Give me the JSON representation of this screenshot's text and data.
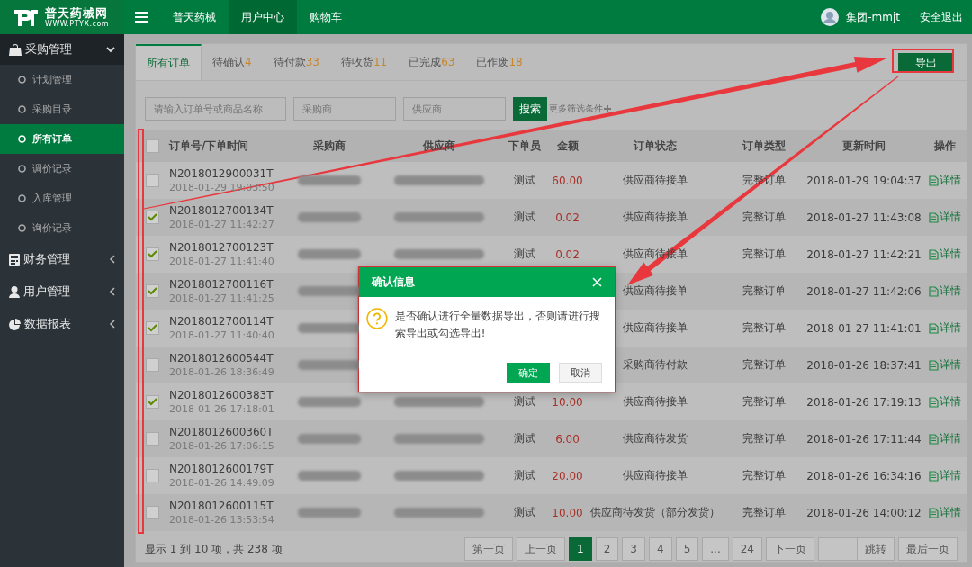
{
  "brand": {
    "name": "普天药械网",
    "url": "WWW.PTYX.com"
  },
  "top_nav": {
    "items": [
      {
        "label": "普天药械",
        "selected": false
      },
      {
        "label": "用户中心",
        "selected": true
      },
      {
        "label": "购物车",
        "selected": false
      }
    ],
    "user": "集团-mmjt",
    "logout": "安全退出"
  },
  "sidebar": {
    "groups": [
      {
        "label": "采购管理",
        "expanded": true,
        "children": [
          {
            "label": "计划管理",
            "selected": false
          },
          {
            "label": "采购目录",
            "selected": false
          },
          {
            "label": "所有订单",
            "selected": true
          },
          {
            "label": "调价记录",
            "selected": false
          },
          {
            "label": "入库管理",
            "selected": false
          },
          {
            "label": "询价记录",
            "selected": false
          }
        ]
      },
      {
        "label": "财务管理",
        "expanded": false
      },
      {
        "label": "用户管理",
        "expanded": false
      },
      {
        "label": "数据报表",
        "expanded": false
      }
    ]
  },
  "tabs": [
    {
      "label": "所有订单",
      "selected": true
    },
    {
      "label": "待确认",
      "count": "4",
      "selected": false
    },
    {
      "label": "待付款",
      "count": "33",
      "selected": false
    },
    {
      "label": "待收货",
      "count": "11",
      "selected": false
    },
    {
      "label": "已完成",
      "count": "63",
      "selected": false
    },
    {
      "label": "已作废",
      "count": "18",
      "selected": false
    }
  ],
  "export_button": "导出",
  "filters": {
    "fields": [
      {
        "placeholder": "请输入订单号或商品名称"
      },
      {
        "placeholder": "采购商"
      },
      {
        "placeholder": "供应商"
      }
    ],
    "search_button": "搜索",
    "more_filters": "更多筛选条件"
  },
  "table": {
    "select_all": {
      "checked": false
    },
    "columns": [
      "订单号/下单时间",
      "采购商",
      "供应商",
      "下单员",
      "金额",
      "订单状态",
      "订单类型",
      "更新时间",
      "操作"
    ],
    "rows": [
      {
        "checked": false,
        "order_no": "N2018012900031T",
        "created": "2018-01-29 19:03:50",
        "staff": "测试",
        "amount": "60.00",
        "status": "供应商待接单",
        "type": "完整订单",
        "updated": "2018-01-29 19:04:37",
        "action": "详情"
      },
      {
        "checked": true,
        "order_no": "N2018012700134T",
        "created": "2018-01-27 11:42:27",
        "staff": "测试",
        "amount": "0.02",
        "status": "供应商待接单",
        "type": "完整订单",
        "updated": "2018-01-27 11:43:08",
        "action": "详情"
      },
      {
        "checked": true,
        "order_no": "N2018012700123T",
        "created": "2018-01-27 11:41:40",
        "staff": "测试",
        "amount": "0.02",
        "status": "供应商待接单",
        "type": "完整订单",
        "updated": "2018-01-27 11:42:21",
        "action": "详情"
      },
      {
        "checked": true,
        "order_no": "N2018012700116T",
        "created": "2018-01-27 11:41:25",
        "status": "供应商待接单",
        "type": "完整订单",
        "updated": "2018-01-27 11:42:06",
        "action": "详情"
      },
      {
        "checked": true,
        "order_no": "N2018012700114T",
        "created": "2018-01-27 11:40:40",
        "status": "供应商待接单",
        "type": "完整订单",
        "updated": "2018-01-27 11:41:01",
        "action": "详情"
      },
      {
        "checked": false,
        "order_no": "N2018012600544T",
        "created": "2018-01-26 18:36:49",
        "status": "采购商待付款",
        "type": "完整订单",
        "updated": "2018-01-26 18:37:41",
        "action": "详情"
      },
      {
        "checked": true,
        "order_no": "N2018012600383T",
        "created": "2018-01-26 17:18:01",
        "staff": "测试",
        "amount": "10.00",
        "status": "供应商待接单",
        "type": "完整订单",
        "updated": "2018-01-26 17:19:13",
        "action": "详情"
      },
      {
        "checked": false,
        "order_no": "N2018012600360T",
        "created": "2018-01-26 17:06:15",
        "staff": "测试",
        "amount": "6.00",
        "status": "供应商待发货",
        "type": "完整订单",
        "updated": "2018-01-26 17:11:44",
        "action": "详情"
      },
      {
        "checked": false,
        "order_no": "N2018012600179T",
        "created": "2018-01-26 14:49:09",
        "staff": "测试",
        "amount": "20.00",
        "status": "供应商待接单",
        "type": "完整订单",
        "updated": "2018-01-26 16:34:16",
        "action": "详情"
      },
      {
        "checked": false,
        "order_no": "N2018012600115T",
        "created": "2018-01-26 13:53:54",
        "staff": "测试",
        "amount": "10.00",
        "status": "供应商待发货（部分发货）",
        "type": "完整订单",
        "updated": "2018-01-26 14:00:12",
        "action": "详情"
      }
    ]
  },
  "pagination": {
    "info": "显示 1 到 10 项，共 238 项",
    "pages": [
      {
        "label": "第一页",
        "selected": false
      },
      {
        "label": "上一页",
        "selected": false
      },
      {
        "label": "1",
        "selected": true
      },
      {
        "label": "2",
        "selected": false
      },
      {
        "label": "3",
        "selected": false
      },
      {
        "label": "4",
        "selected": false
      },
      {
        "label": "5",
        "selected": false
      },
      {
        "label": "...",
        "selected": false
      },
      {
        "label": "24",
        "selected": false
      },
      {
        "label": "下一页",
        "selected": false
      }
    ],
    "jump_button": "跳转",
    "last_button": "最后一页"
  },
  "dialog": {
    "title": "确认信息",
    "message": "是否确认进行全量数据导出，否则请进行搜索导出或勾选导出!",
    "buttons": [
      {
        "label": "确定",
        "kind": "primary"
      },
      {
        "label": "取消",
        "kind": "secondary"
      }
    ]
  }
}
